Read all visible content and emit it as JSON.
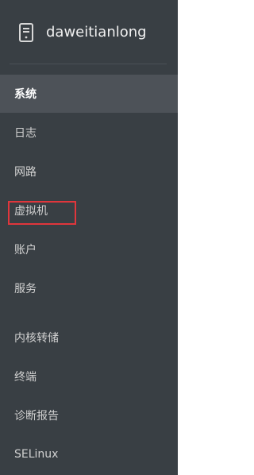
{
  "host": {
    "name": "daweitianlong",
    "icon": "server-icon"
  },
  "nav": {
    "items": [
      {
        "label": "系统",
        "active": true
      },
      {
        "label": "日志",
        "active": false
      },
      {
        "label": "网路",
        "active": false
      },
      {
        "label": "虚拟机",
        "active": false,
        "highlighted": true
      },
      {
        "label": "账户",
        "active": false
      },
      {
        "label": "服务",
        "active": false
      },
      {
        "label": "内核转储",
        "active": false
      },
      {
        "label": "终端",
        "active": false
      },
      {
        "label": "诊断报告",
        "active": false
      },
      {
        "label": "SELinux",
        "active": false
      }
    ]
  },
  "colors": {
    "sidebar_bg": "#393f44",
    "active_bg": "#4d5258",
    "highlight": "#e0363c"
  }
}
